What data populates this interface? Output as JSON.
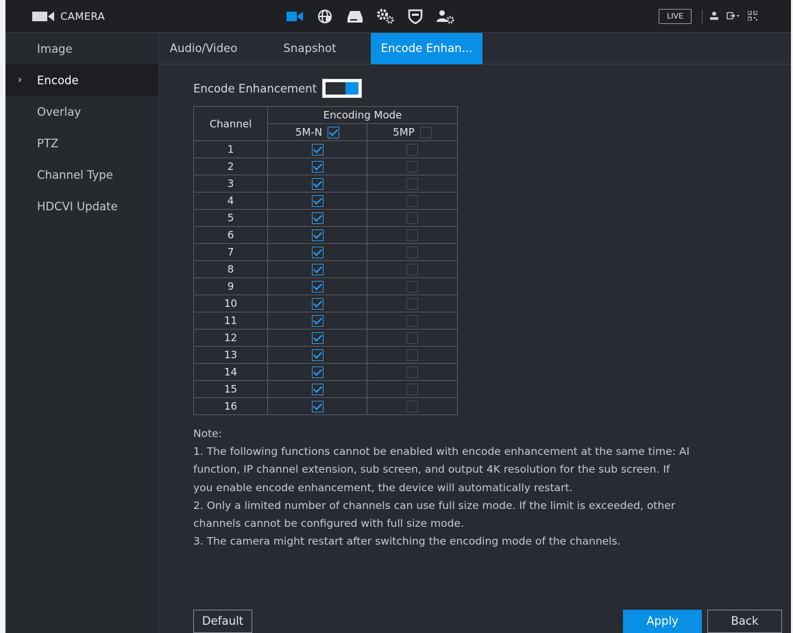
{
  "header": {
    "title": "CAMERA",
    "live_label": "LIVE",
    "icons": [
      "camera-icon",
      "network-icon",
      "storage-icon",
      "system-icon",
      "event-shield-icon",
      "account-icon"
    ],
    "right_icons": [
      "user-icon",
      "logout-icon",
      "qr-code-icon"
    ]
  },
  "sidebar": {
    "items": [
      {
        "label": "Image",
        "active": false
      },
      {
        "label": "Encode",
        "active": true
      },
      {
        "label": "Overlay",
        "active": false
      },
      {
        "label": "PTZ",
        "active": false
      },
      {
        "label": "Channel Type",
        "active": false
      },
      {
        "label": "HDCVI Update",
        "active": false
      }
    ]
  },
  "tabs": [
    {
      "label": "Audio/Video",
      "active": false
    },
    {
      "label": "Snapshot",
      "active": false
    },
    {
      "label": "Encode Enhan...",
      "active": true
    }
  ],
  "encode_enhancement": {
    "label": "Encode Enhancement",
    "enabled": true
  },
  "table": {
    "channel_header": "Channel",
    "mode_header": "Encoding Mode",
    "mode1_label": "5M-N",
    "mode1_all_checked": true,
    "mode2_label": "5MP",
    "mode2_all_checked": false,
    "rows": [
      {
        "channel": "1",
        "m1": true,
        "m2": false
      },
      {
        "channel": "2",
        "m1": true,
        "m2": false
      },
      {
        "channel": "3",
        "m1": true,
        "m2": false
      },
      {
        "channel": "4",
        "m1": true,
        "m2": false
      },
      {
        "channel": "5",
        "m1": true,
        "m2": false
      },
      {
        "channel": "6",
        "m1": true,
        "m2": false
      },
      {
        "channel": "7",
        "m1": true,
        "m2": false
      },
      {
        "channel": "8",
        "m1": true,
        "m2": false
      },
      {
        "channel": "9",
        "m1": true,
        "m2": false
      },
      {
        "channel": "10",
        "m1": true,
        "m2": false
      },
      {
        "channel": "11",
        "m1": true,
        "m2": false
      },
      {
        "channel": "12",
        "m1": true,
        "m2": false
      },
      {
        "channel": "13",
        "m1": true,
        "m2": false
      },
      {
        "channel": "14",
        "m1": true,
        "m2": false
      },
      {
        "channel": "15",
        "m1": true,
        "m2": false
      },
      {
        "channel": "16",
        "m1": true,
        "m2": false
      }
    ]
  },
  "note": {
    "title": "Note:",
    "lines": [
      "1. The following functions cannot be enabled with encode enhancement at the same time: AI",
      "function, IP channel extension, sub screen, and output 4K resolution for the sub screen. If",
      "you enable encode enhancement, the device will automatically restart.",
      "2. Only a limited number of channels can use full size mode. If the limit is exceeded, other",
      "channels cannot be configured with full size mode.",
      "3. The camera might restart after switching the encoding mode of the channels."
    ]
  },
  "buttons": {
    "default_label": "Default",
    "apply_label": "Apply",
    "back_label": "Back"
  },
  "colors": {
    "accent": "#0a8fe6",
    "background": "#282b31",
    "sidebar": "#26292e",
    "topbar": "#1e2024"
  }
}
